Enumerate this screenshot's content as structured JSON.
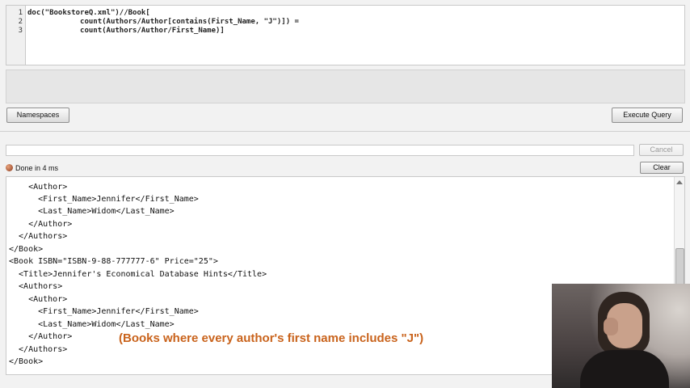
{
  "editor": {
    "line_numbers": [
      "1",
      "2",
      "3"
    ],
    "lines": [
      "doc(\"BookstoreQ.xml\")//Book[",
      "            count(Authors/Author[contains(First_Name, \"J\")]) =",
      "            count(Authors/Author/First_Name)]"
    ]
  },
  "toolbar": {
    "namespaces_label": "Namespaces",
    "execute_label": "Execute Query",
    "cancel_label": "Cancel",
    "clear_label": "Clear"
  },
  "status": {
    "text": "Done in 4 ms"
  },
  "results": {
    "lines": [
      "    <Author>",
      "      <First_Name>Jennifer</First_Name>",
      "      <Last_Name>Widom</Last_Name>",
      "    </Author>",
      "  </Authors>",
      "</Book>",
      "<Book ISBN=\"ISBN-9-88-777777-6\" Price=\"25\">",
      "  <Title>Jennifer's Economical Database Hints</Title>",
      "  <Authors>",
      "    <Author>",
      "      <First_Name>Jennifer</First_Name>",
      "      <Last_Name>Widom</Last_Name>",
      "    </Author>",
      "  </Authors>",
      "</Book>"
    ]
  },
  "caption": {
    "text": "(Books where every author's first name includes \"J\")",
    "color": "#c9631c"
  },
  "icons": {
    "status": "status-done-icon",
    "scroll_up": "scroll-up-arrow-icon"
  }
}
